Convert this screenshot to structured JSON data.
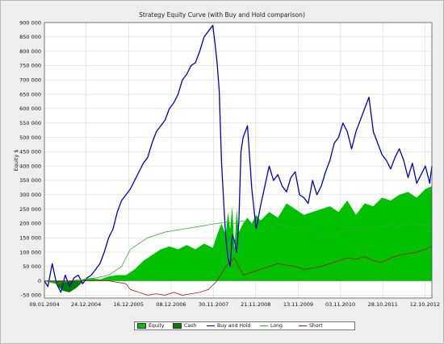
{
  "chart_data": {
    "type": "area",
    "title": "Strategy Equity Curve (with Buy and Hold comparison)",
    "ylabel": "Equity $",
    "xlabel": "",
    "ylim": [
      -60000,
      900000
    ],
    "yticks": [
      "900 000",
      "850 000",
      "800 000",
      "750 000",
      "700 000",
      "650 000",
      "600 000",
      "550 000",
      "500 000",
      "450 000",
      "400 000",
      "350 000",
      "300 000",
      "250 000",
      "200 000",
      "150 000",
      "100 000",
      "50 000",
      "0",
      "-50 000"
    ],
    "ytick_values": [
      900000,
      850000,
      800000,
      750000,
      700000,
      650000,
      600000,
      550000,
      500000,
      450000,
      400000,
      350000,
      300000,
      250000,
      200000,
      150000,
      100000,
      50000,
      0,
      -50000
    ],
    "xticks": [
      "09.01.2004",
      "24.12.2004",
      "16.12.2005",
      "08.12.2006",
      "30.11.2007",
      "21.11.2008",
      "13.11.2009",
      "03.11.2010",
      "28.10.2011",
      "12.10.2012"
    ],
    "xtick_values": [
      2004.02,
      2004.98,
      2005.96,
      2006.94,
      2007.92,
      2008.89,
      2009.87,
      2010.84,
      2011.82,
      2012.79
    ],
    "xlim": [
      2004.02,
      2012.95
    ],
    "grid": true,
    "legend_position": "bottom",
    "series": [
      {
        "name": "Equity",
        "kind": "area",
        "color": "#00c000",
        "x": [
          2004.02,
          2004.3,
          2004.5,
          2004.7,
          2004.9,
          2005.1,
          2005.3,
          2005.5,
          2005.7,
          2005.9,
          2006.1,
          2006.3,
          2006.5,
          2006.7,
          2006.9,
          2007.1,
          2007.3,
          2007.5,
          2007.7,
          2007.9,
          2008.0,
          2008.1,
          2008.2,
          2008.25,
          2008.3,
          2008.35,
          2008.4,
          2008.45,
          2008.5,
          2008.6,
          2008.7,
          2008.8,
          2008.9,
          2009.0,
          2009.2,
          2009.4,
          2009.6,
          2009.8,
          2010.0,
          2010.2,
          2010.4,
          2010.6,
          2010.8,
          2011.0,
          2011.2,
          2011.4,
          2011.6,
          2011.8,
          2012.0,
          2012.2,
          2012.4,
          2012.6,
          2012.8,
          2012.95
        ],
        "values": [
          0,
          -10000,
          -20000,
          -30000,
          5000,
          10000,
          5000,
          15000,
          20000,
          20000,
          40000,
          70000,
          90000,
          110000,
          120000,
          110000,
          125000,
          110000,
          130000,
          115000,
          160000,
          200000,
          160000,
          240000,
          180000,
          260000,
          110000,
          250000,
          170000,
          200000,
          220000,
          200000,
          230000,
          210000,
          240000,
          220000,
          270000,
          250000,
          230000,
          240000,
          250000,
          260000,
          240000,
          280000,
          230000,
          270000,
          260000,
          290000,
          280000,
          300000,
          310000,
          290000,
          320000,
          330000
        ]
      },
      {
        "name": "Cash",
        "kind": "area",
        "color": "#008000",
        "x": [
          2004.3,
          2004.45,
          2004.6,
          2004.75,
          2004.9
        ],
        "values": [
          -15000,
          -35000,
          -40000,
          -25000,
          -5000
        ]
      },
      {
        "name": "Buy and Hold",
        "kind": "line",
        "color": "#0000c0",
        "x": [
          2004.02,
          2004.1,
          2004.2,
          2004.3,
          2004.4,
          2004.5,
          2004.6,
          2004.7,
          2004.8,
          2004.9,
          2005.0,
          2005.1,
          2005.2,
          2005.3,
          2005.4,
          2005.5,
          2005.6,
          2005.7,
          2005.8,
          2005.9,
          2006.0,
          2006.1,
          2006.2,
          2006.3,
          2006.4,
          2006.5,
          2006.6,
          2006.7,
          2006.8,
          2006.9,
          2007.0,
          2007.1,
          2007.2,
          2007.3,
          2007.4,
          2007.5,
          2007.6,
          2007.7,
          2007.8,
          2007.9,
          2007.95,
          2008.0,
          2008.05,
          2008.1,
          2008.15,
          2008.2,
          2008.25,
          2008.3,
          2008.35,
          2008.4,
          2008.45,
          2008.5,
          2008.55,
          2008.6,
          2008.7,
          2008.8,
          2008.9,
          2009.0,
          2009.1,
          2009.2,
          2009.3,
          2009.4,
          2009.5,
          2009.6,
          2009.7,
          2009.8,
          2009.9,
          2010.0,
          2010.1,
          2010.2,
          2010.3,
          2010.4,
          2010.5,
          2010.6,
          2010.7,
          2010.8,
          2010.9,
          2011.0,
          2011.1,
          2011.2,
          2011.3,
          2011.4,
          2011.5,
          2011.6,
          2011.7,
          2011.8,
          2011.9,
          2012.0,
          2012.1,
          2012.2,
          2012.3,
          2012.4,
          2012.5,
          2012.6,
          2012.7,
          2012.8,
          2012.9,
          2012.95
        ],
        "values": [
          0,
          -20000,
          60000,
          -10000,
          -40000,
          20000,
          -20000,
          10000,
          20000,
          -10000,
          10000,
          20000,
          40000,
          60000,
          100000,
          150000,
          180000,
          240000,
          280000,
          300000,
          320000,
          350000,
          380000,
          410000,
          430000,
          480000,
          520000,
          540000,
          560000,
          600000,
          620000,
          650000,
          700000,
          720000,
          750000,
          760000,
          800000,
          850000,
          870000,
          890000,
          830000,
          760000,
          660000,
          420000,
          280000,
          150000,
          80000,
          50000,
          160000,
          140000,
          100000,
          200000,
          450000,
          500000,
          540000,
          320000,
          180000,
          260000,
          330000,
          400000,
          350000,
          370000,
          330000,
          310000,
          360000,
          380000,
          300000,
          290000,
          270000,
          350000,
          300000,
          330000,
          380000,
          420000,
          480000,
          500000,
          550000,
          520000,
          460000,
          520000,
          560000,
          600000,
          640000,
          520000,
          480000,
          440000,
          420000,
          390000,
          430000,
          460000,
          420000,
          360000,
          410000,
          340000,
          370000,
          400000,
          340000,
          400000
        ]
      },
      {
        "name": "Long",
        "kind": "line",
        "color": "#38a838",
        "x": [
          2004.02,
          2004.3,
          2004.6,
          2004.9,
          2005.2,
          2005.5,
          2005.8,
          2006.0,
          2006.2,
          2006.4,
          2006.6,
          2006.8,
          2007.0,
          2007.2,
          2007.4,
          2007.6,
          2007.8,
          2008.0,
          2008.2,
          2008.4,
          2008.6,
          2008.8,
          2009.0,
          2009.2,
          2009.4,
          2009.6,
          2009.8,
          2010.0,
          2010.2,
          2010.4,
          2010.6,
          2010.8,
          2011.0,
          2011.2,
          2011.4,
          2011.6,
          2011.8,
          2012.0,
          2012.2,
          2012.4,
          2012.6,
          2012.8,
          2012.95
        ],
        "values": [
          0,
          -10000,
          0,
          5000,
          10000,
          20000,
          50000,
          110000,
          130000,
          150000,
          160000,
          170000,
          175000,
          180000,
          185000,
          190000,
          195000,
          200000,
          205000,
          200000,
          210000,
          190000,
          170000,
          180000,
          200000,
          190000,
          185000,
          180000,
          175000,
          160000,
          150000,
          170000,
          180000,
          175000,
          185000,
          180000,
          190000,
          195000,
          190000,
          200000,
          195000,
          195000,
          190000
        ]
      },
      {
        "name": "Short",
        "kind": "line",
        "color": "#a81818",
        "x": [
          2004.02,
          2005.0,
          2005.5,
          2005.9,
          2006.0,
          2006.2,
          2006.4,
          2006.6,
          2006.8,
          2007.0,
          2007.2,
          2007.4,
          2007.6,
          2007.8,
          2008.0,
          2008.2,
          2008.4,
          2008.6,
          2008.8,
          2009.0,
          2009.2,
          2009.4,
          2009.6,
          2009.8,
          2010.0,
          2010.2,
          2010.4,
          2010.6,
          2010.8,
          2011.0,
          2011.2,
          2011.4,
          2011.6,
          2011.8,
          2012.0,
          2012.2,
          2012.4,
          2012.6,
          2012.8,
          2012.95
        ],
        "values": [
          0,
          0,
          0,
          -10000,
          -30000,
          -40000,
          -50000,
          -45000,
          -50000,
          -40000,
          -50000,
          -45000,
          -40000,
          -30000,
          0,
          50000,
          80000,
          20000,
          30000,
          40000,
          50000,
          60000,
          55000,
          50000,
          40000,
          45000,
          50000,
          60000,
          70000,
          80000,
          75000,
          85000,
          70000,
          65000,
          80000,
          90000,
          95000,
          100000,
          110000,
          120000
        ]
      }
    ]
  },
  "legend": {
    "items": [
      {
        "label": "Equity",
        "kind": "fill",
        "color": "#00c000"
      },
      {
        "label": "Cash",
        "kind": "fill",
        "color": "#008000"
      },
      {
        "label": "Buy and Hold",
        "kind": "line",
        "color": "#0000c0"
      },
      {
        "label": "Long",
        "kind": "line",
        "color": "#38a838"
      },
      {
        "label": "Short",
        "kind": "line",
        "color": "#a81818"
      }
    ]
  }
}
